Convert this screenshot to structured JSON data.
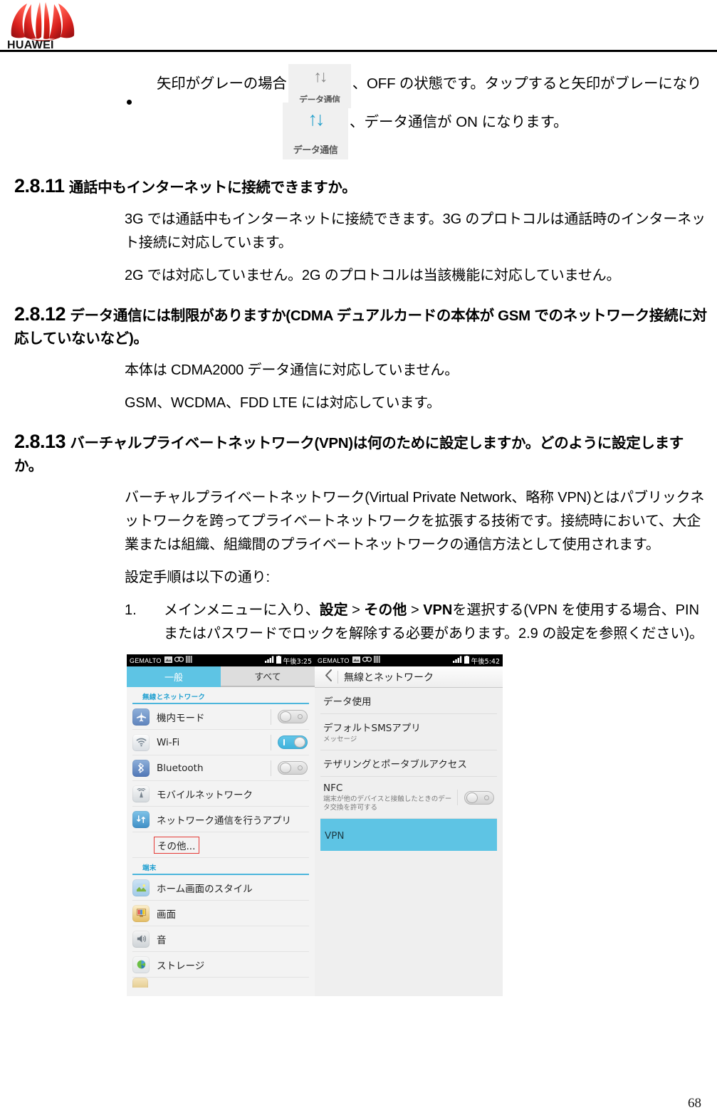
{
  "header": {
    "logo_name": "huawei-logo",
    "logo_wordmark": "HUAWEI"
  },
  "bullet": {
    "text_before_icon": "矢印がグレーの場合",
    "icon_off": {
      "name": "data-communication-icon-off",
      "arrows": "↑↓",
      "label": "データ通信",
      "color": "#8a8a8a"
    },
    "text_after_icon": "、OFF の状態です。タップすると矢印がブレーになり",
    "icon_on": {
      "name": "data-communication-icon-on",
      "arrows": "↑↓",
      "label": "データ通信",
      "color": "#2ba3cd"
    },
    "text_line2": "、データ通信が ON になります。"
  },
  "sections": [
    {
      "number": "2.8.11",
      "title": "通話中もインターネットに接続できますか。",
      "paragraphs": [
        "3G では通話中もインターネットに接続できます。3G のプロトコルは通話時のインターネット接続に対応しています。",
        "2G では対応していません。2G のプロトコルは当該機能に対応していません。"
      ]
    },
    {
      "number": "2.8.12",
      "title": "データ通信には制限がありますか(CDMA デュアルカードの本体が GSM でのネットワーク接続に対応していないなど)。",
      "paragraphs": [
        "本体は CDMA2000 データ通信に対応していません。",
        "GSM、WCDMA、FDD LTE には対応しています。"
      ]
    },
    {
      "number": "2.8.13",
      "title": "バーチャルプライベートネットワーク(VPN)は何のために設定しますか。どのように設定しますか。",
      "paragraphs": [
        "バーチャルプライベートネットワーク(Virtual Private Network、略称 VPN)とはパブリックネットワークを跨ってプライベートネットワークを拡張する技術です。接続時において、大企業または組織、組織間のプライベートネットワークの通信方法として使用されます。",
        "設定手順は以下の通り:"
      ]
    }
  ],
  "steps": [
    {
      "number": "1.",
      "prefix": "メインメニューに入り、",
      "bold1": "設定",
      "sep1": " > ",
      "bold2": "その他",
      "sep2": " > ",
      "bold3": "VPN",
      "suffix": "を選択する(VPN を使用する場合、PIN またはパスワードでロックを解除する必要があります。2.9 の設定を参照ください)。"
    }
  ],
  "screenshots": {
    "left_phone": {
      "statusbar": {
        "carrier": "GEMALTO",
        "icons": [
          "picture-icon",
          "voicemail-icon",
          "sim-icon"
        ],
        "signal_icon": "signal-bars-icon",
        "battery_icon": "battery-icon",
        "time": "午後3:25"
      },
      "tabs": [
        {
          "label": "一般",
          "active": true
        },
        {
          "label": "すべて",
          "active": false
        }
      ],
      "groups": [
        {
          "label": "無線とネットワーク",
          "items": [
            {
              "label": "機内モード",
              "icon": "airplane-icon",
              "icon_color": "#6a8fc4",
              "toggle": "off"
            },
            {
              "label": "Wi-Fi",
              "icon": "wifi-icon",
              "icon_color": "#9aa4ad",
              "toggle": "on"
            },
            {
              "label": "Bluetooth",
              "icon": "bluetooth-icon",
              "icon_color": "#5b7fc1",
              "toggle": "off"
            },
            {
              "label": "モバイルネットワーク",
              "icon": "cell-tower-icon",
              "icon_color": "#a9b0b6",
              "toggle": "none"
            },
            {
              "label": "ネットワーク通信を行うアプリ",
              "icon": "network-apps-icon",
              "icon_color": "#5aa6d6",
              "toggle": "none"
            },
            {
              "label": "その他...",
              "icon": "none",
              "icon_color": "",
              "toggle": "none",
              "highlighted": true
            }
          ]
        },
        {
          "label": "端末",
          "items": [
            {
              "label": "ホーム画面のスタイル",
              "icon": "home-style-icon",
              "icon_color": "#8db869",
              "toggle": "none"
            },
            {
              "label": "画面",
              "icon": "display-icon",
              "icon_color": "#c9a24a",
              "toggle": "none"
            },
            {
              "label": "音",
              "icon": "sound-icon",
              "icon_color": "#8c9299",
              "toggle": "none"
            },
            {
              "label": "ストレージ",
              "icon": "storage-icon",
              "icon_color": "#6ab04c",
              "toggle": "none"
            }
          ]
        }
      ]
    },
    "right_phone": {
      "statusbar": {
        "carrier": "GEMALTO",
        "icons": [
          "picture-icon",
          "voicemail-icon",
          "sim-icon"
        ],
        "signal_icon": "signal-bars-icon",
        "battery_icon": "battery-icon",
        "time": "午後5:42"
      },
      "actionbar": {
        "back_icon": "back-chevron-icon",
        "title": "無線とネットワーク"
      },
      "items": [
        {
          "title": "データ使用",
          "sub": "",
          "toggle": "none",
          "highlighted": false
        },
        {
          "title": "デフォルトSMSアプリ",
          "sub": "メッセージ",
          "toggle": "none",
          "highlighted": false
        },
        {
          "title": "テザリングとポータブルアクセス",
          "sub": "",
          "toggle": "none",
          "highlighted": false
        },
        {
          "title": "NFC",
          "sub": "端末が他のデバイスと接触したときのデータ交換を許可する",
          "toggle": "off",
          "highlighted": false
        },
        {
          "title": "VPN",
          "sub": "",
          "toggle": "none",
          "highlighted": true
        }
      ]
    }
  },
  "footer": {
    "page_number": "68"
  },
  "colors": {
    "accent_blue": "#5ec4e4",
    "section_blue": "#1f9fd0",
    "highlight_red": "#e53935",
    "brand_red": "#e2231a"
  }
}
